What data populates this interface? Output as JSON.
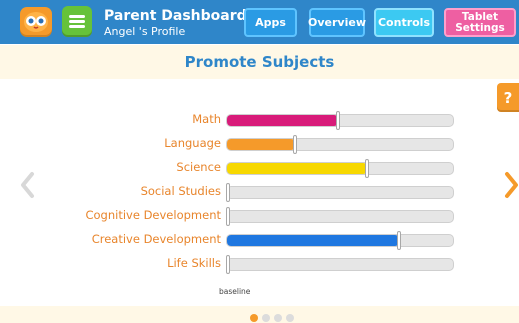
{
  "header": {
    "title": "Parent Dashboard",
    "subtitle": "Angel 's Profile",
    "tabs": [
      {
        "label": "Apps"
      },
      {
        "label": "Overview"
      },
      {
        "label": "Controls"
      },
      {
        "label": "Tablet Settings"
      }
    ]
  },
  "section": {
    "title": "Promote Subjects"
  },
  "help": {
    "label": "?"
  },
  "subjects": [
    {
      "label": "Math",
      "value": 0.49,
      "color": "#d81b7a"
    },
    {
      "label": "Language",
      "value": 0.3,
      "color": "#f59a2a"
    },
    {
      "label": "Science",
      "value": 0.62,
      "color": "#f7d800"
    },
    {
      "label": "Social Studies",
      "value": 0.0,
      "color": "#2f86c9"
    },
    {
      "label": "Cognitive Development",
      "value": 0.0,
      "color": "#2f86c9"
    },
    {
      "label": "Creative Development",
      "value": 0.76,
      "color": "#1f77e0"
    },
    {
      "label": "Life Skills",
      "value": 0.0,
      "color": "#2f86c9"
    }
  ],
  "baseline_label": "baseline",
  "pagination": {
    "pages": 4,
    "current": 1
  },
  "colors": {
    "header_bg": "#2f86c9",
    "accent_orange": "#f59a2a",
    "label_orange": "#e8852c",
    "section_title": "#2f86c9"
  },
  "icons": {
    "logo": "owl-face-icon",
    "menu": "hamburger-menu-icon",
    "prev": "chevron-left-icon",
    "next": "chevron-right-icon"
  }
}
